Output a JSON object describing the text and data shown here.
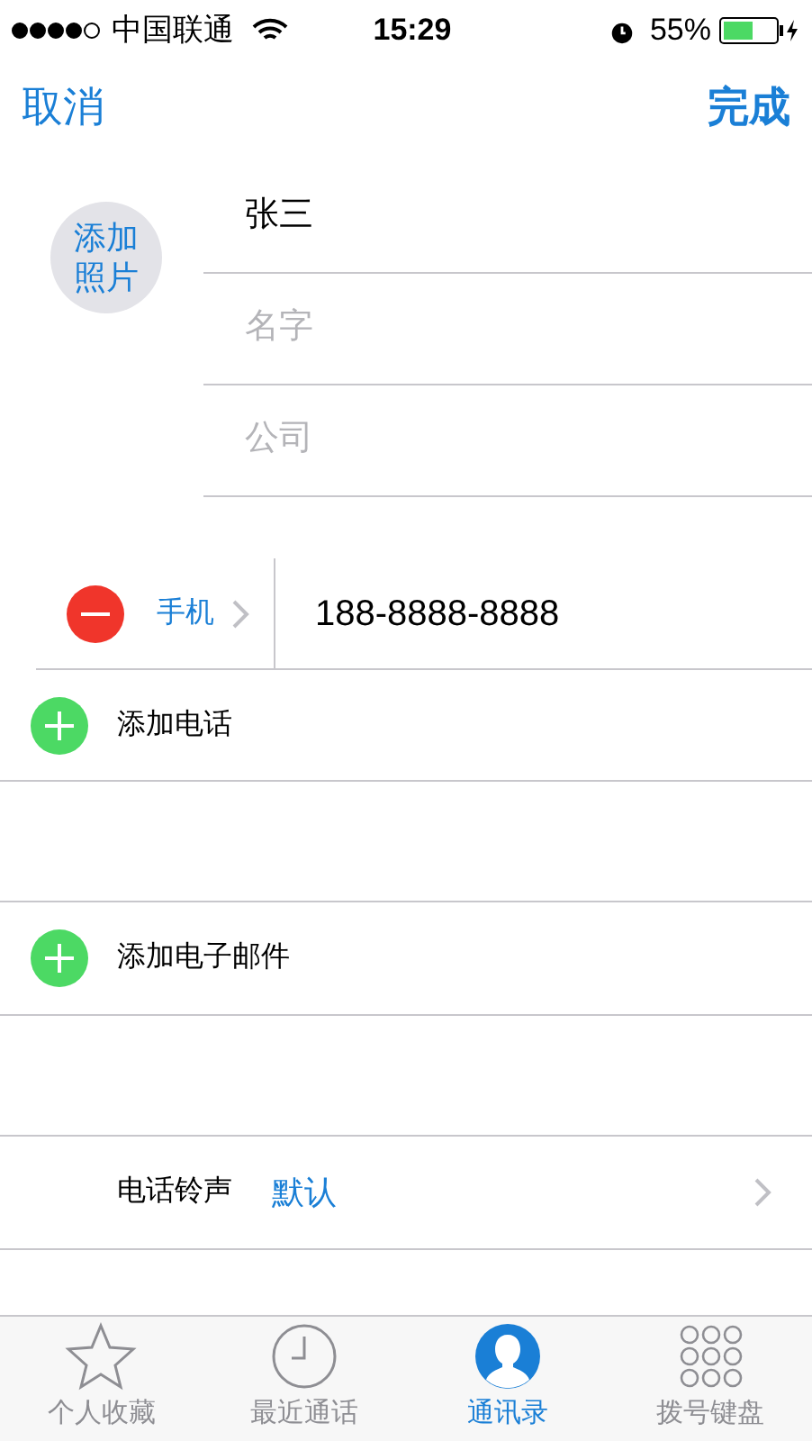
{
  "status_bar": {
    "carrier": "中国联通",
    "time": "15:29",
    "battery": "55%"
  },
  "nav": {
    "cancel": "取消",
    "done": "完成"
  },
  "photo_button": "添加照片",
  "name_fields": [
    {
      "value": "张三"
    },
    {
      "placeholder": "名字"
    },
    {
      "placeholder": "公司"
    }
  ],
  "phones": [
    {
      "label": "手机",
      "value": "188-8888-8888"
    }
  ],
  "add_phone": "添加电话",
  "add_email": "添加电子邮件",
  "ringtone": {
    "label": "电话铃声",
    "value": "默认"
  },
  "tabs": [
    {
      "label": "个人收藏",
      "kind": "star",
      "selected": false
    },
    {
      "label": "最近通话",
      "kind": "clock",
      "selected": false
    },
    {
      "label": "通讯录",
      "kind": "person",
      "selected": true
    },
    {
      "label": "拨号键盘",
      "kind": "keypad",
      "selected": false
    }
  ]
}
